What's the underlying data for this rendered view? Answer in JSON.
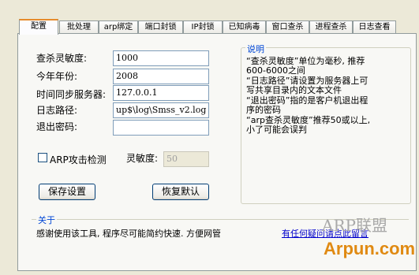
{
  "tabs": [
    "配置",
    "批处理",
    "arp绑定",
    "端口封锁",
    "IP封锁",
    "已知病毒",
    "窗口查杀",
    "进程查杀",
    "日志查看"
  ],
  "form": {
    "sensitivity_label": "查杀灵敏度:",
    "sensitivity_value": "1000",
    "year_label": "今年年份:",
    "year_value": "2008",
    "timeserver_label": "时间同步服务器:",
    "timeserver_value": "127.0.0.1",
    "logpath_label": "日志路径:",
    "logpath_value": "up$\\log\\Smss_v2.log",
    "exitpwd_label": "退出密码:",
    "exitpwd_value": ""
  },
  "arp": {
    "checkbox_label": "ARP攻击检测",
    "checked": false,
    "sensitivity_label": "灵敏度:",
    "sensitivity_value": "50"
  },
  "buttons": {
    "save": "保存设置",
    "restore": "恢复默认"
  },
  "help": {
    "title": "说明",
    "lines": [
      "“查杀灵敏度”单位为毫秒, 推荐",
      "600-6000之间",
      "“日志路径”请设置为服务器上可",
      "写共享目录内的文本文件",
      "“退出密码”指的是客户机退出程",
      "序的密码",
      "“arp查杀灵敏度”推荐50或以上,",
      "小了可能会误判"
    ]
  },
  "about": {
    "title": "关于",
    "text": "感谢使用该工具, 程序尽可能简约快速. 方便网管",
    "link": "有任何疑问请点此留言"
  },
  "watermark": {
    "line1": "ARP联盟",
    "line2": "Arpun.com"
  },
  "colors": {
    "window_bg": "#ece9d8",
    "panel_bg": "#f8f8f5",
    "group_title": "#0046d5",
    "active_tab_accent": "#e68b2c",
    "link": "#0000cc",
    "watermark_orange": "#e08a12"
  }
}
